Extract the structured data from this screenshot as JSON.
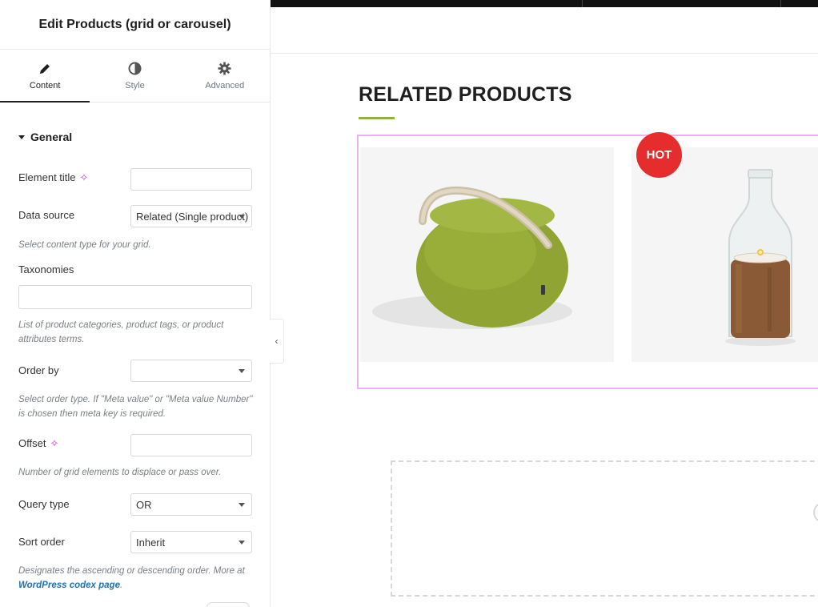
{
  "panel": {
    "title": "Edit Products (grid or carousel)",
    "tabs": [
      {
        "label": "Content",
        "icon": "pencil-icon",
        "active": true
      },
      {
        "label": "Style",
        "icon": "half-circle-icon",
        "active": false
      },
      {
        "label": "Advanced",
        "icon": "gear-icon",
        "active": false
      }
    ],
    "section": "General",
    "fields": {
      "element_title": {
        "label": "Element title",
        "value": ""
      },
      "data_source": {
        "label": "Data source",
        "value": "Related (Single product)",
        "description": "Select content type for your grid."
      },
      "taxonomies": {
        "label": "Taxonomies",
        "value": "",
        "description": "List of product categories, product tags, or product attributes terms."
      },
      "order_by": {
        "label": "Order by",
        "value": "",
        "description": "Select order type. If \"Meta value\" or \"Meta value Number\" is chosen then meta key is required."
      },
      "offset": {
        "label": "Offset",
        "value": "",
        "description": "Number of grid elements to displace or pass over."
      },
      "query_type": {
        "label": "Query type",
        "value": "OR"
      },
      "sort_order": {
        "label": "Sort order",
        "value": "Inherit",
        "description_prefix": "Designates the ascending or descending order. More at ",
        "description_link": "WordPress codex page",
        "description_suffix": "."
      }
    },
    "collapse_icon": "chevron-left-icon"
  },
  "preview": {
    "heading": "RELATED PRODUCTS",
    "badge": "HOT",
    "accent_color": "#8cb33c",
    "badge_color": "#e52d2d"
  }
}
